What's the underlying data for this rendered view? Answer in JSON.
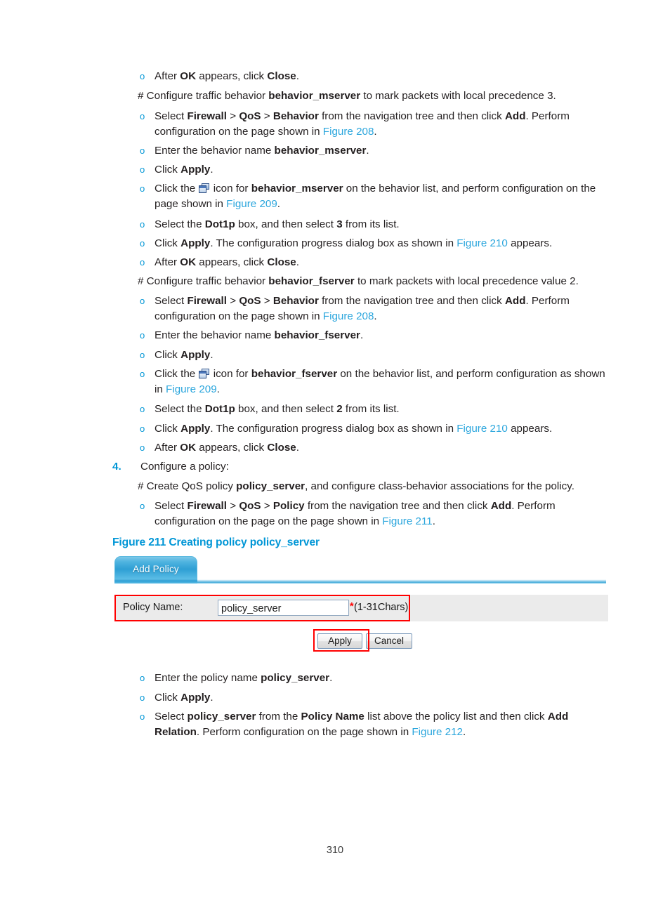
{
  "page": {
    "number": "310"
  },
  "body": {
    "item_1": {
      "bullet": "o",
      "pre": "After ",
      "b1": "OK",
      "mid": " appears, click ",
      "b2": "Close",
      "post": "."
    },
    "hash_1": {
      "pre": "# Configure traffic behavior ",
      "b1": "behavior_mserver",
      "post": " to mark packets with local precedence 3."
    },
    "item_2": {
      "bullet": "o",
      "pre": "Select ",
      "b1": "Firewall",
      "sep1": " > ",
      "b2": "QoS",
      "sep2": " > ",
      "b3": "Behavior",
      "mid": " from the navigation tree and then click ",
      "b4": "Add",
      "mid2": ". Perform configuration on the page shown in ",
      "xref": "Figure 208",
      "post": "."
    },
    "item_3": {
      "bullet": "o",
      "pre": "Enter the behavior name ",
      "b1": "behavior_mserver",
      "post": "."
    },
    "item_4": {
      "bullet": "o",
      "pre": "Click ",
      "b1": "Apply",
      "post": "."
    },
    "item_5": {
      "bullet": "o",
      "pre": "Click the ",
      "icon": "config-window-icon",
      "mid": " icon for ",
      "b1": "behavior_mserver",
      "mid2": " on the behavior list, and perform configuration on the page shown in ",
      "xref": "Figure 209",
      "post": "."
    },
    "item_6": {
      "bullet": "o",
      "pre": "Select the ",
      "b1": "Dot1p",
      "mid": " box, and then select ",
      "b2": "3",
      "post": " from its list."
    },
    "item_7": {
      "bullet": "o",
      "pre": "Click ",
      "b1": "Apply",
      "mid": ". The configuration progress dialog box as shown in ",
      "xref": "Figure 210",
      "post": " appears."
    },
    "item_8": {
      "bullet": "o",
      "pre": "After ",
      "b1": "OK",
      "mid": " appears, click ",
      "b2": "Close",
      "post": "."
    },
    "hash_2": {
      "pre": "# Configure traffic behavior ",
      "b1": "behavior_fserver",
      "post": " to mark packets with local precedence value 2."
    },
    "item_9": {
      "bullet": "o",
      "pre": "Select ",
      "b1": "Firewall",
      "sep1": " > ",
      "b2": "QoS",
      "sep2": " > ",
      "b3": "Behavior",
      "mid": " from the navigation tree and then click ",
      "b4": "Add",
      "mid2": ". Perform configuration on the page shown in ",
      "xref": "Figure 208",
      "post": "."
    },
    "item_10": {
      "bullet": "o",
      "pre": "Enter the behavior name ",
      "b1": "behavior_fserver",
      "post": "."
    },
    "item_11": {
      "bullet": "o",
      "pre": "Click ",
      "b1": "Apply",
      "post": "."
    },
    "item_12": {
      "bullet": "o",
      "pre": "Click the ",
      "icon": "config-window-icon",
      "mid": " icon for ",
      "b1": "behavior_fserver",
      "mid2": " on the behavior list, and perform configuration as shown in ",
      "xref": "Figure 209",
      "post": "."
    },
    "item_13": {
      "bullet": "o",
      "pre": "Select the ",
      "b1": "Dot1p",
      "mid": " box, and then select ",
      "b2": "2",
      "post": " from its list."
    },
    "item_14": {
      "bullet": "o",
      "pre": "Click ",
      "b1": "Apply",
      "mid": ". The configuration progress dialog box as shown in ",
      "xref": "Figure 210",
      "post": " appears."
    },
    "item_15": {
      "bullet": "o",
      "pre": "After ",
      "b1": "OK",
      "mid": " appears, click ",
      "b2": "Close",
      "post": "."
    },
    "step_4": {
      "number": "4.",
      "text": "Configure a policy:"
    },
    "hash_3": {
      "pre": "# Create QoS policy ",
      "b1": "policy_server",
      "post": ", and configure class-behavior associations for the policy."
    },
    "item_16": {
      "bullet": "o",
      "pre": "Select ",
      "b1": "Firewall",
      "sep1": " > ",
      "b2": "QoS",
      "sep2": " > ",
      "b3": "Policy",
      "mid": " from the navigation tree and then click ",
      "b4": "Add",
      "mid2": ". Perform configuration on the page on the page shown in ",
      "xref": "Figure 211",
      "post": "."
    },
    "figure_caption": "Figure 211 Creating policy policy_server",
    "item_17": {
      "bullet": "o",
      "pre": "Enter the policy name ",
      "b1": "policy_server",
      "post": "."
    },
    "item_18": {
      "bullet": "o",
      "pre": "Click ",
      "b1": "Apply",
      "post": "."
    },
    "item_19": {
      "bullet": "o",
      "pre": "Select ",
      "b1": "policy_server",
      "mid": " from the ",
      "b2": "Policy Name",
      "mid2": " list above the policy list and then click ",
      "b3": "Add Relation",
      "mid3": ". Perform configuration on the page shown in ",
      "xref": "Figure 212",
      "post": "."
    }
  },
  "figure_ui": {
    "tab_label": "Add Policy",
    "policy_name_label": "Policy Name:",
    "policy_name_value": "policy_server",
    "required_marker": "*",
    "length_hint": "(1-31Chars)",
    "apply_button": "Apply",
    "cancel_button": "Cancel",
    "highlight_color": "#ff0000",
    "tab_accent_color": "#2e9fd4",
    "row_background": "#ebebeb"
  },
  "colors": {
    "link": "#2ba6dd",
    "heading": "#0096d6",
    "text": "#231f20"
  }
}
